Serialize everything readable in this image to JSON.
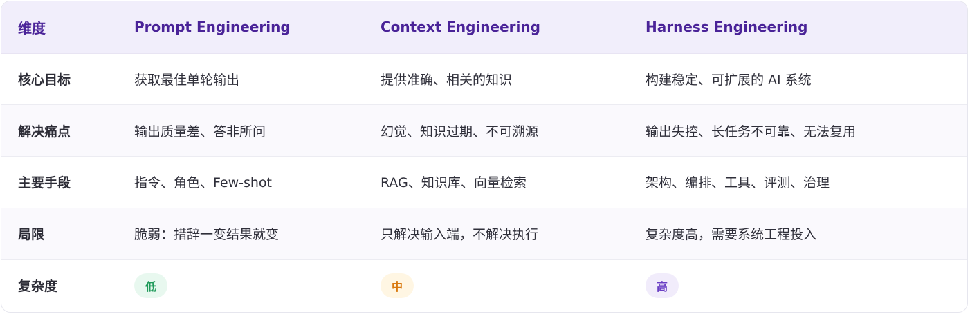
{
  "headers": [
    "维度",
    "Prompt Engineering",
    "Context Engineering",
    "Harness Engineering"
  ],
  "rows": [
    {
      "dimension": "核心目标",
      "prompt": "获取最佳单轮输出",
      "context": "提供准确、相关的知识",
      "harness": "构建稳定、可扩展的 AI 系统"
    },
    {
      "dimension": "解决痛点",
      "prompt": "输出质量差、答非所问",
      "context": "幻觉、知识过期、不可溯源",
      "harness": "输出失控、长任务不可靠、无法复用"
    },
    {
      "dimension": "主要手段",
      "prompt": "指令、角色、Few-shot",
      "context": "RAG、知识库、向量检索",
      "harness": "架构、编排、工具、评测、治理"
    },
    {
      "dimension": "局限",
      "prompt": "脆弱：措辞一变结果就变",
      "context": "只解决输入端，不解决执行",
      "harness": "复杂度高，需要系统工程投入"
    }
  ],
  "complexity": {
    "dimension": "复杂度",
    "prompt": "低",
    "context": "中",
    "harness": "高"
  },
  "colors": {
    "header_bg": "#f1eefb",
    "header_text": "#4a2398",
    "low": "#1f9a5a",
    "mid": "#d9790f",
    "high": "#6a3fc4"
  }
}
